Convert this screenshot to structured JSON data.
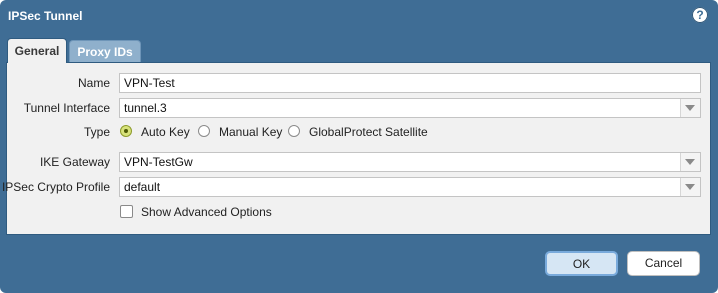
{
  "dialog": {
    "title": "IPSec Tunnel",
    "help_icon": "?"
  },
  "tabs": [
    {
      "label": "General",
      "active": true
    },
    {
      "label": "Proxy IDs",
      "active": false
    }
  ],
  "form": {
    "name": {
      "label": "Name",
      "value": "VPN-Test"
    },
    "tunnel_interface": {
      "label": "Tunnel Interface",
      "value": "tunnel.3"
    },
    "type": {
      "label": "Type",
      "options": [
        "Auto Key",
        "Manual Key",
        "GlobalProtect Satellite"
      ],
      "selected": "Auto Key"
    },
    "ike_gateway": {
      "label": "IKE Gateway",
      "value": "VPN-TestGw"
    },
    "ipsec_crypto_profile": {
      "label": "IPSec Crypto Profile",
      "value": "default"
    },
    "show_advanced": {
      "label": "Show Advanced Options",
      "checked": false
    }
  },
  "buttons": {
    "ok": "OK",
    "cancel": "Cancel"
  },
  "colors": {
    "dialog_background": "#3f6d95",
    "panel_background": "#f1f1f1",
    "active_tab": "#f1f1f1",
    "inactive_tab": "#8fb0cc",
    "radio_selected": "#d7e27a",
    "ok_button_border": "#79aadb"
  }
}
